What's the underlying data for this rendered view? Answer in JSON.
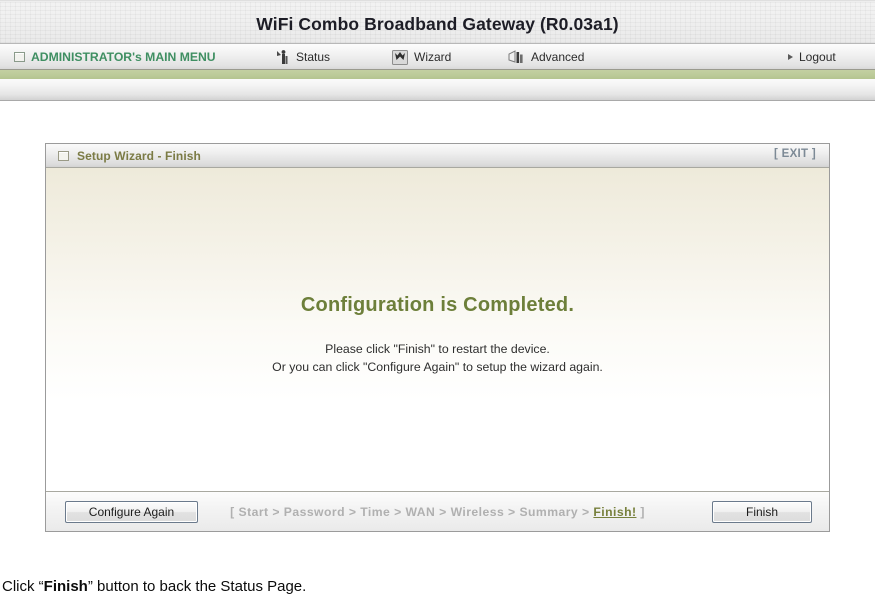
{
  "header": {
    "title": "WiFi Combo Broadband Gateway (R0.03a1)"
  },
  "nav": {
    "main_menu": {
      "label": "ADMINISTRATOR's MAIN MENU",
      "icon": "window-icon",
      "color": "#3f8f62"
    },
    "items": [
      {
        "label": "Status",
        "icon": "status-antenna-icon"
      },
      {
        "label": "Wizard",
        "icon": "wizard-hat-icon"
      },
      {
        "label": "Advanced",
        "icon": "advanced-tools-icon"
      }
    ],
    "logout": {
      "label": "Logout",
      "icon": "arrow-right-icon"
    }
  },
  "panel": {
    "title": "Setup Wizard - Finish",
    "exit_label": "[ EXIT ]",
    "headline": "Configuration is Completed.",
    "line1": "Please click \"Finish\" to restart the device.",
    "line2": "Or you can click \"Configure Again\" to setup the wizard again.",
    "title_color": "#7b7b45",
    "headline_color": "#6d7f3a"
  },
  "footer": {
    "configure_again_label": "Configure Again",
    "finish_label": "Finish",
    "breadcrumb": {
      "open_bracket": "[ ",
      "steps": [
        "Start",
        "Password",
        "Time",
        "WAN",
        "Wireless",
        "Summary"
      ],
      "separator": " > ",
      "current": "Finish!",
      "close_bracket": " ]",
      "inactive_color": "#b0b0b0",
      "current_color": "#77803c"
    }
  },
  "caption": {
    "prefix": "Click “",
    "bold": "Finish",
    "suffix": "” button to back the Status Page."
  }
}
